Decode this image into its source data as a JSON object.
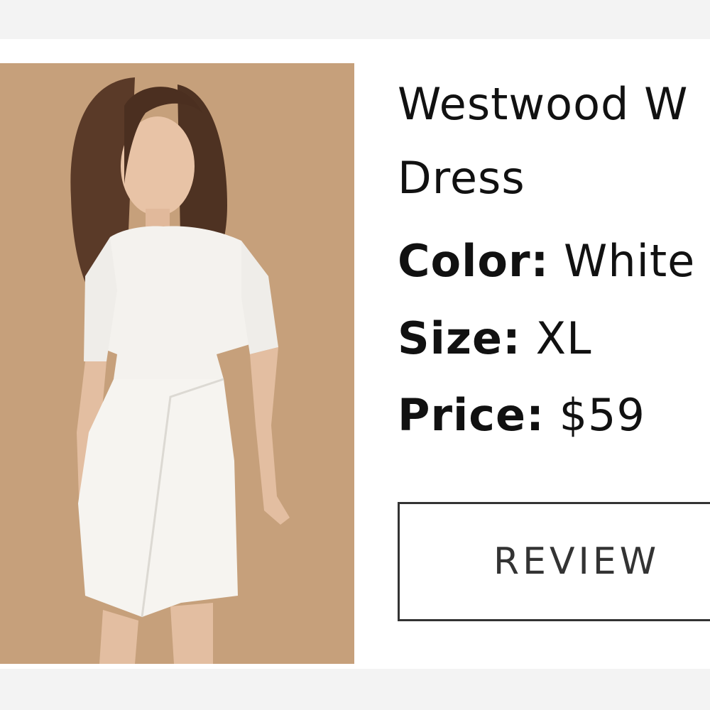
{
  "product": {
    "title_line1": "Westwood W",
    "title_line2": "Dress",
    "color_label": "Color:",
    "color_value": "White",
    "size_label": "Size:",
    "size_value": "XL",
    "price_label": "Price:",
    "price_value": "$59",
    "image_alt": "Model wearing white short-sleeve wrap dress",
    "photo_background": "#c8a07a"
  },
  "actions": {
    "review_label": "REVIEW"
  }
}
